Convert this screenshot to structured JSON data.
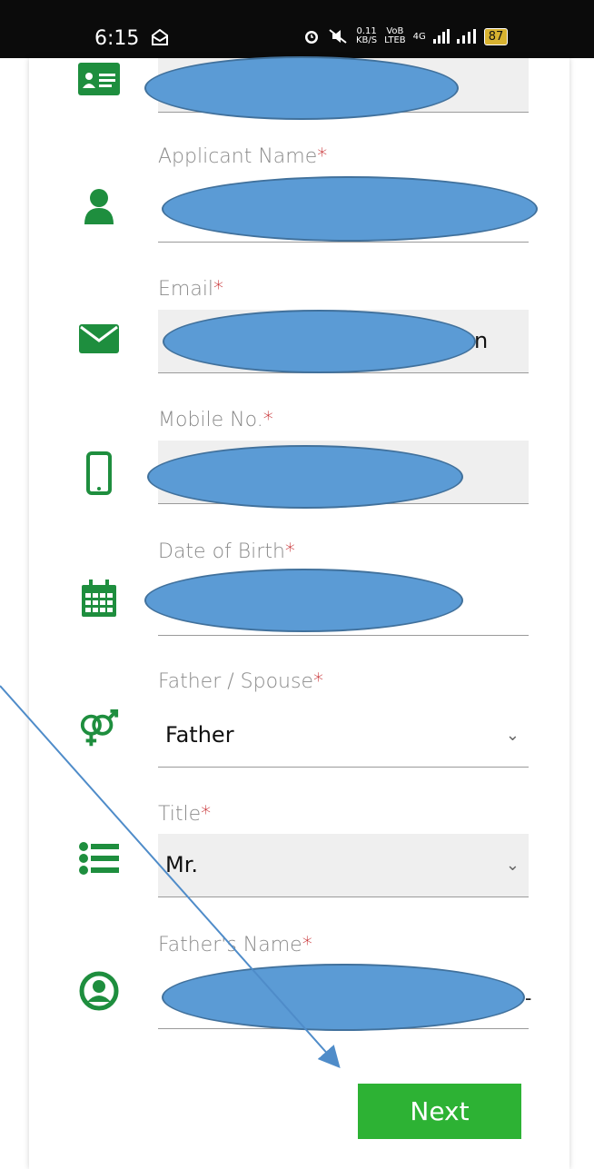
{
  "status_bar": {
    "time": "6:15",
    "net_speed_top": "0.11",
    "net_speed_bottom": "KB/S",
    "volte_top": "VoB",
    "volte_bottom": "LTEB",
    "network": "4G",
    "battery": "87"
  },
  "form": {
    "applicant_name_label": "Applicant Name",
    "email_label": "Email",
    "email_value_tail": "n",
    "mobile_label": "Mobile No.",
    "dob_label": "Date of Birth",
    "father_spouse_label": "Father / Spouse",
    "father_spouse_value": "Father",
    "title_label": "Title",
    "title_value": "Mr.",
    "fathers_name_label": "Father's Name",
    "required_mark": "*"
  },
  "next_button": "Next",
  "colors": {
    "icon_green": "#1e8e3e",
    "button_green": "#2db234",
    "redaction_blue": "#5b9bd5",
    "required_red": "#c0161a"
  },
  "icons": [
    "id-card-icon",
    "user-icon",
    "envelope-icon",
    "mobile-icon",
    "calendar-icon",
    "gender-icon",
    "list-icon",
    "user-circle-icon",
    "chevron-down-icon"
  ]
}
